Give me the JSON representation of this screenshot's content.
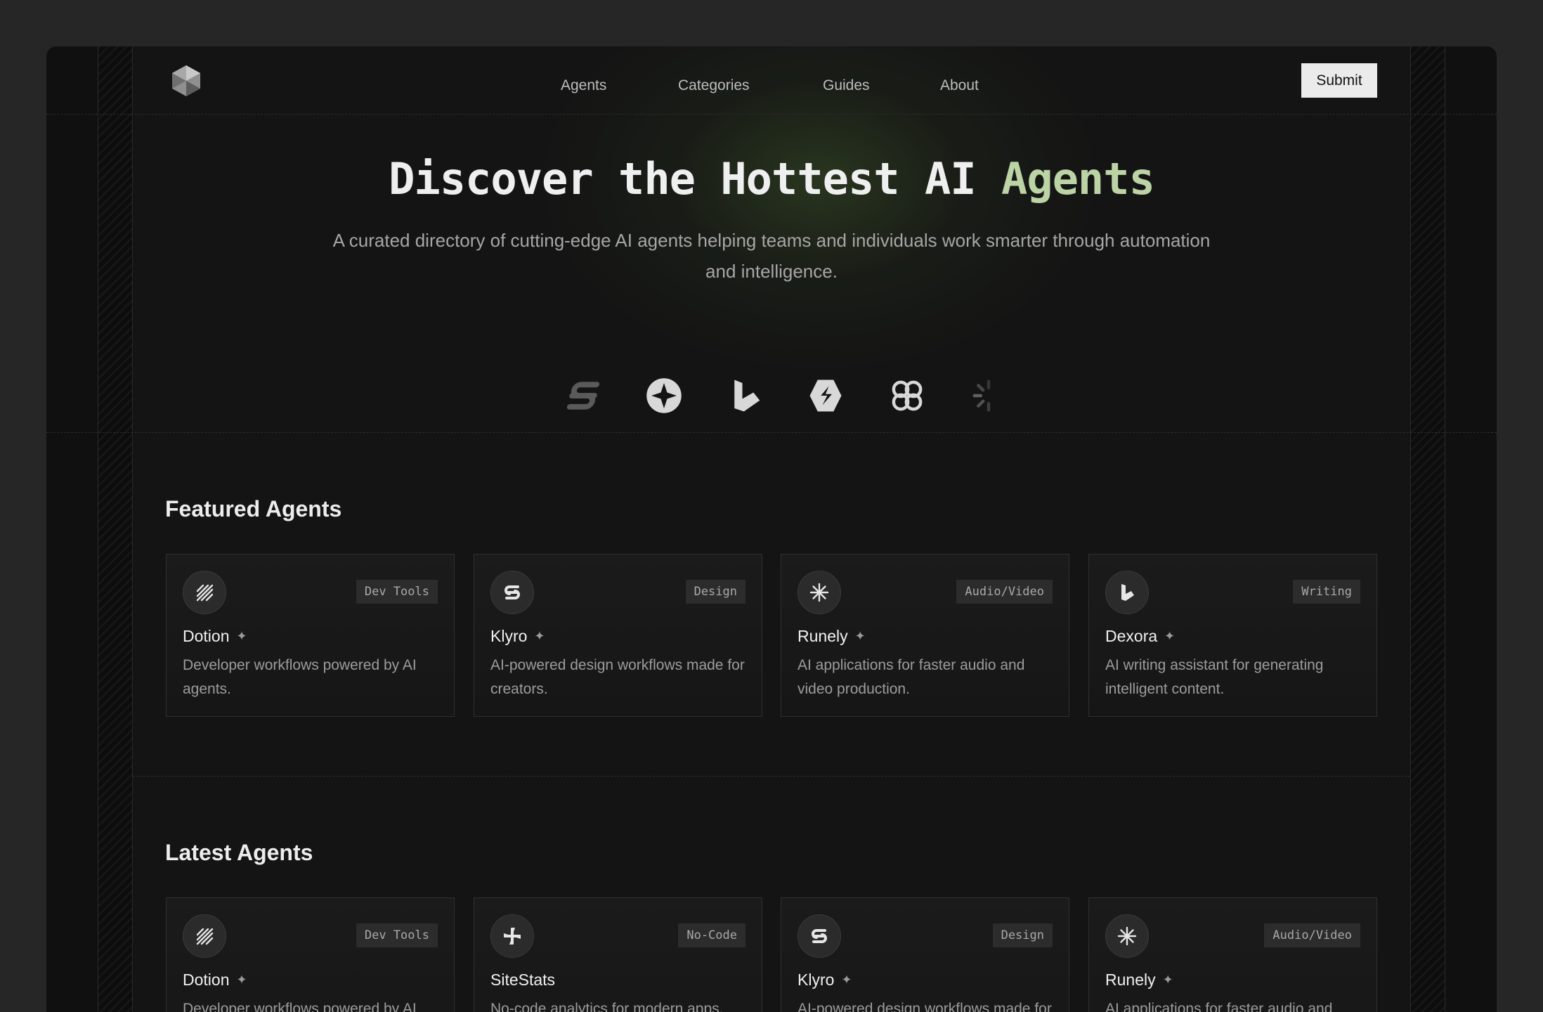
{
  "nav": {
    "items": [
      "Agents",
      "Categories",
      "Guides",
      "About"
    ],
    "submit_label": "Submit"
  },
  "hero": {
    "title_main": "Discover the Hottest AI ",
    "title_accent": "Agents",
    "subtitle": "A curated directory of cutting-edge AI agents helping teams and individuals work smarter through automation and intelligence.",
    "brand_icons": [
      "klyro-logo-icon",
      "star-circle-logo-icon",
      "dexora-logo-icon",
      "hexagon-logo-icon",
      "clover-logo-icon",
      "spinner-logo-icon"
    ]
  },
  "featured": {
    "title": "Featured Agents",
    "cards": [
      {
        "name": "Dotion",
        "tag": "Dev Tools",
        "desc": "Developer workflows powered by AI agents.",
        "icon": "diagonal-lines-icon"
      },
      {
        "name": "Klyro",
        "tag": "Design",
        "desc": "AI-powered design workflows made for creators.",
        "icon": "klyro-icon"
      },
      {
        "name": "Runely",
        "tag": "Audio/Video",
        "desc": "AI applications for faster audio and video production.",
        "icon": "asterisk-icon"
      },
      {
        "name": "Dexora",
        "tag": "Writing",
        "desc": "AI writing assistant for generating intelligent content.",
        "icon": "dexora-icon"
      }
    ]
  },
  "latest": {
    "title": "Latest Agents",
    "cards": [
      {
        "name": "Dotion",
        "tag": "Dev Tools",
        "desc": "Developer workflows powered by AI agents.",
        "icon": "diagonal-lines-icon"
      },
      {
        "name": "SiteStats",
        "tag": "No-Code",
        "desc": "No-code analytics for modern apps.",
        "icon": "pinwheel-icon"
      },
      {
        "name": "Klyro",
        "tag": "Design",
        "desc": "AI-powered design workflows made for creators.",
        "icon": "klyro-icon"
      },
      {
        "name": "Runely",
        "tag": "Audio/Video",
        "desc": "AI applications for faster audio and video production.",
        "icon": "asterisk-icon"
      }
    ]
  },
  "colors": {
    "page_bg": "#262626",
    "frame_bg": "#101010",
    "accent_green": "#bcd3a6",
    "button_bg": "#ebebeb"
  }
}
